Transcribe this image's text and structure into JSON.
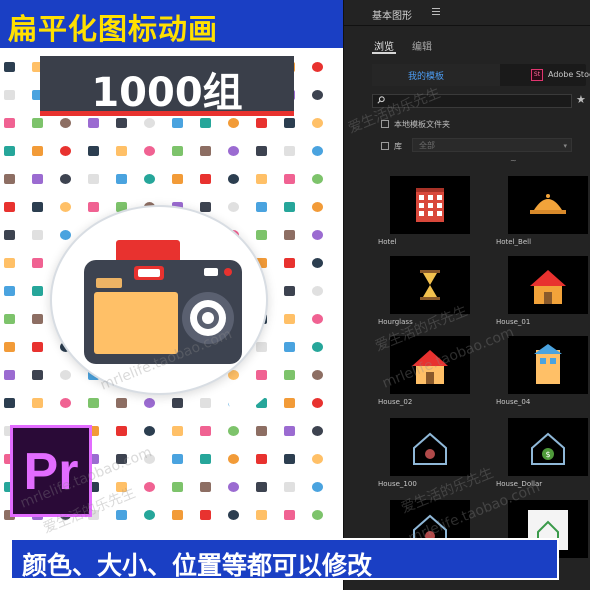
{
  "promo": {
    "headline": "扁平化图标动画",
    "count_text": "1000组",
    "pr_logo_text": "Pr",
    "bottom_text": "颜色、大小、位置等都可以修改",
    "colors": {
      "banner_blue": "#1a3fc4",
      "headline_yellow": "#ffe000",
      "accent_red": "#e8322f",
      "pr_purple": "#e26cff"
    }
  },
  "panel": {
    "title": "基本图形",
    "tabs": [
      {
        "label": "浏览",
        "active": true
      },
      {
        "label": "编辑",
        "active": false
      }
    ],
    "source_my_templates": "我的模板",
    "stock_badge": "St",
    "source_stock": "Adobe Stock",
    "checkbox_local": "本地模板文件夹",
    "checkbox_library": "库",
    "library_select_value": "全部",
    "sort_mark": "~",
    "templates": [
      {
        "label": "Hotel",
        "icon": "hotel-building-icon"
      },
      {
        "label": "Hotel_Bell",
        "icon": "service-bell-icon"
      },
      {
        "label": "Hourglass",
        "icon": "hourglass-icon"
      },
      {
        "label": "House_01",
        "icon": "house-icon"
      },
      {
        "label": "House_02",
        "icon": "house-icon"
      },
      {
        "label": "House_04",
        "icon": "house-icon"
      },
      {
        "label": "House_100",
        "icon": "house-outline-icon"
      },
      {
        "label": "House_Dollar",
        "icon": "house-dollar-icon"
      },
      {
        "label": "",
        "icon": "house-outline-icon"
      },
      {
        "label": "",
        "icon": "monitor-house-icon"
      }
    ]
  },
  "watermark": {
    "cn": "爱生活的乐先生",
    "url": "mrlelife.taobao.com"
  }
}
